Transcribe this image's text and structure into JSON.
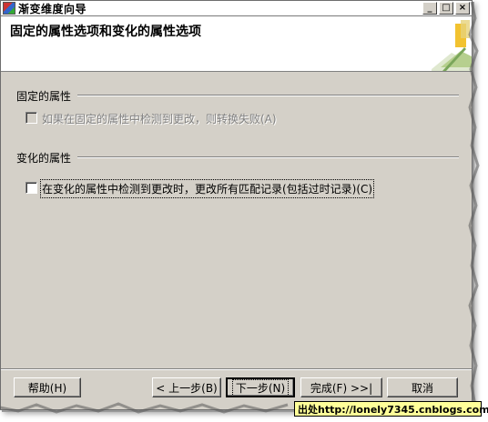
{
  "window": {
    "title": "渐变维度向导",
    "controls": {
      "minimize": "_",
      "maximize": "□",
      "close": "×"
    }
  },
  "header": {
    "title": "固定的属性选项和变化的属性选项"
  },
  "fixed_section": {
    "label": "固定的属性",
    "checkbox_label": "如果在固定的属性中检测到更改，则转换失败(A)",
    "checked": false,
    "enabled": false
  },
  "changing_section": {
    "label": "变化的属性",
    "checkbox_label": "在变化的属性中检测到更改时，更改所有匹配记录(包括过时记录)(C)",
    "checked": false,
    "enabled": true
  },
  "footer": {
    "help": "帮助(H)",
    "back": "< 上一步(B)",
    "next": "下一步(N)",
    "finish": "完成(F) >>|",
    "cancel": "取消"
  },
  "watermark": {
    "text": "出处http://lonely7345.cnblogs.com"
  },
  "colors": {
    "dialog_bg": "#d4d0c8",
    "header_bg": "#ffffff",
    "disabled_text": "#808080",
    "watermark_bg": "#ffff99"
  }
}
